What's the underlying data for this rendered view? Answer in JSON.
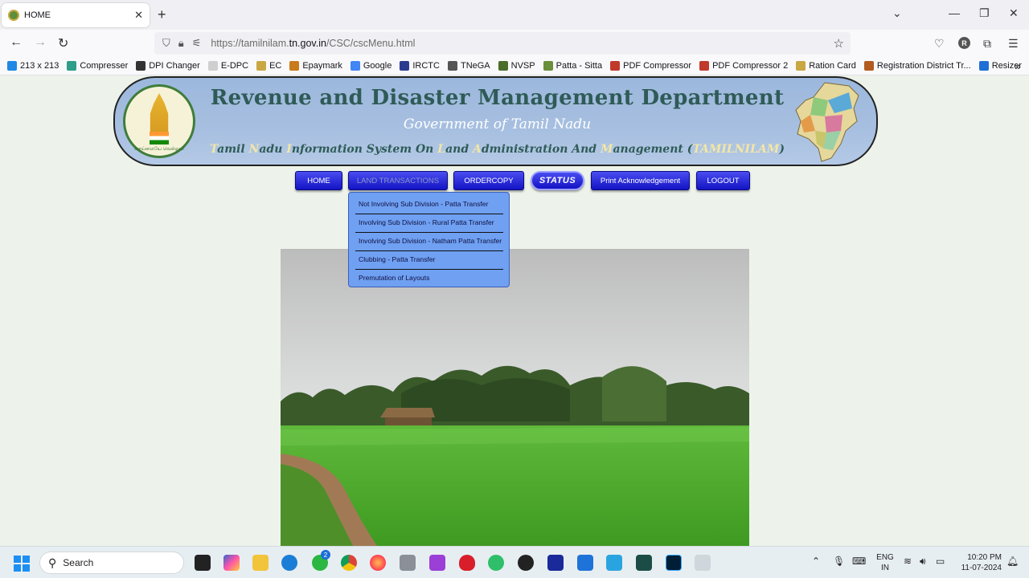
{
  "browser": {
    "tab_title": "HOME",
    "tab_close": "✕",
    "new_tab": "+",
    "url_prefix": "https://tamilnilam.",
    "url_domain": "tn.gov.in",
    "url_path": "/CSC/cscMenu.html",
    "bookmarks": [
      {
        "label": "213 x 213",
        "color": "#1e88e5"
      },
      {
        "label": "Compresser",
        "color": "#2e9d8a"
      },
      {
        "label": "DPI Changer",
        "color": "#333333"
      },
      {
        "label": "E-DPC",
        "color": "#cfcfcf"
      },
      {
        "label": "EC",
        "color": "#c9a742"
      },
      {
        "label": "Epaymark",
        "color": "#c97a1a"
      },
      {
        "label": "Google",
        "color": "#4285f4"
      },
      {
        "label": "IRCTC",
        "color": "#2a3b8f"
      },
      {
        "label": "TNeGA",
        "color": "#555555"
      },
      {
        "label": "NVSP",
        "color": "#4a6e2a"
      },
      {
        "label": "Patta - Sitta",
        "color": "#6b8f3a"
      },
      {
        "label": "PDF Compressor",
        "color": "#c0392b"
      },
      {
        "label": "PDF Compressor 2",
        "color": "#c0392b"
      },
      {
        "label": "Ration Card",
        "color": "#c9a742"
      },
      {
        "label": "Registration District Tr...",
        "color": "#b35a1f"
      },
      {
        "label": "Resizer",
        "color": "#1e6fd6"
      }
    ]
  },
  "banner": {
    "title": "Revenue and Disaster Management Department",
    "subtitle": "Government of Tamil Nadu",
    "tagline_parts": [
      "T",
      "amil ",
      "N",
      "adu ",
      "I",
      "nformation System On ",
      "L",
      "and ",
      "A",
      "dministration And ",
      "M",
      "anagement (",
      "TAMILNILAM",
      ")"
    ],
    "emblem_text": "வாய்மையே வெல்லும்"
  },
  "menu": {
    "home": "HOME",
    "land_transactions": "LAND TRANSACTIONS",
    "ordercopy": "ORDERCOPY",
    "status": "STATUS",
    "print_ack": "Print Acknowledgement",
    "logout": "LOGOUT"
  },
  "dropdown": [
    "Not Involving Sub Division - Patta Transfer",
    "Involving Sub Division - Rural Patta Transfer",
    "Involving Sub Division - Natham Patta Transfer",
    "Clubbing - Patta Transfer",
    "Premutation of Layouts"
  ],
  "taskbar": {
    "search_label": "Search",
    "whatsapp_badge": "2",
    "lang_line1": "ENG",
    "lang_line2": "IN",
    "time": "10:20 PM",
    "date": "11-07-2024"
  }
}
